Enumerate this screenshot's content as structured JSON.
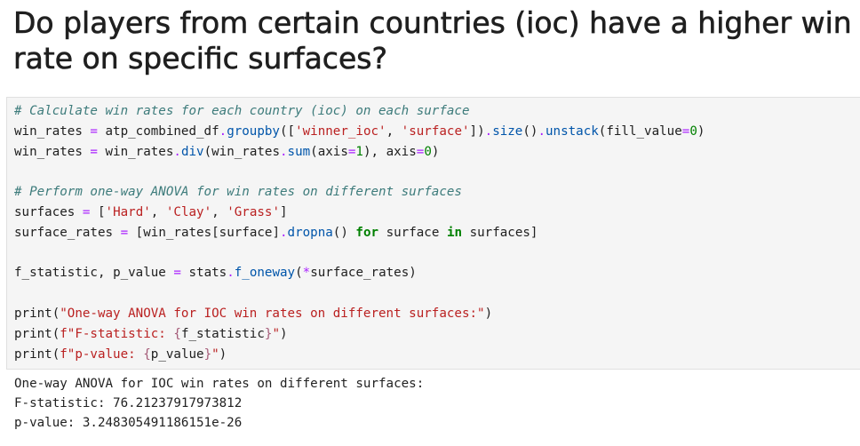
{
  "heading": {
    "line1": "Do players from certain countries (ioc) have a higher win",
    "line2": "rate on specific surfaces?"
  },
  "code": {
    "comment1": "# Calculate win rates for each country (ioc) on each surface",
    "comment2": "# Perform one-way ANOVA for win rates on different surfaces",
    "var_win_rates": "win_rates",
    "var_df": "atp_combined_df",
    "m_groupby": "groupby",
    "str_winner_ioc": "'winner_ioc'",
    "str_surface": "'surface'",
    "m_size": "size",
    "m_unstack": "unstack",
    "kw_fill_value": "fill_value",
    "num_0": "0",
    "num_1": "1",
    "m_div": "div",
    "m_sum": "sum",
    "kw_axis": "axis",
    "var_surfaces": "surfaces",
    "str_hard": "'Hard'",
    "str_clay": "'Clay'",
    "str_grass": "'Grass'",
    "var_surface_rates": "surface_rates",
    "var_surface": "surface",
    "m_dropna": "dropna",
    "kw_for": "for",
    "kw_in": "in",
    "var_f_statistic": "f_statistic",
    "var_p_value": "p_value",
    "var_stats": "stats",
    "m_f_oneway": "f_oneway",
    "fn_print": "print",
    "str_print1": "\"One-way ANOVA for IOC win rates on different surfaces:\"",
    "str_print2_pre": "f\"F-statistic: ",
    "str_print3_pre": "f\"p-value: ",
    "str_quote": "\""
  },
  "output": {
    "line1": "One-way ANOVA for IOC win rates on different surfaces:",
    "line2": "F-statistic: 76.21237917973812",
    "line3": "p-value: 3.248305491186151e-26"
  },
  "colors": {
    "comment": "#3d7b7b",
    "operator": "#aa22ff",
    "string": "#ba2121",
    "number": "#008000",
    "keyword": "#008000",
    "method": "#0055aa",
    "interpolation": "#a45a77",
    "cell_background": "#f5f5f5"
  }
}
